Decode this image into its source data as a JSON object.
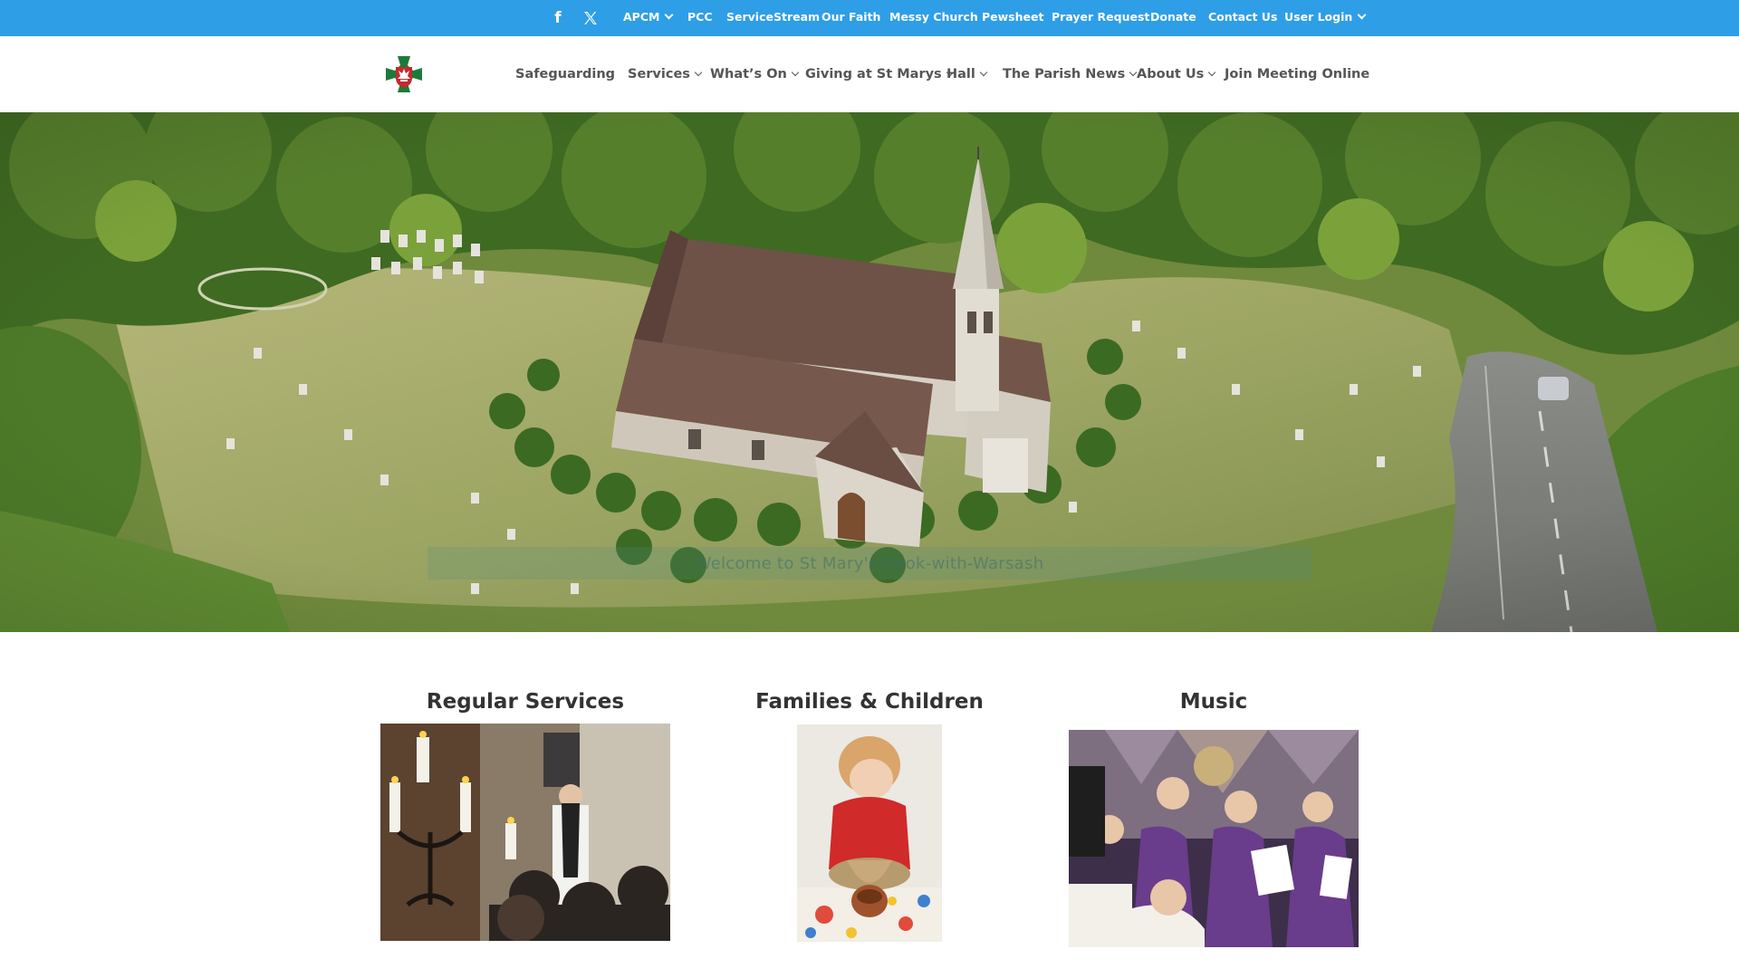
{
  "topbar": {
    "social": [
      "facebook-icon",
      "x-twitter-icon"
    ],
    "links": [
      {
        "label": "APCM",
        "dropdown": true
      },
      {
        "label": "PCC",
        "dropdown": false
      },
      {
        "label": "ServiceStream",
        "dropdown": false
      },
      {
        "label": "Our Faith",
        "dropdown": false
      },
      {
        "label": "Messy Church",
        "dropdown": false
      },
      {
        "label": "Pewsheet",
        "dropdown": false
      },
      {
        "label": "Prayer Request",
        "dropdown": false
      },
      {
        "label": "Donate",
        "dropdown": false
      },
      {
        "label": "Contact Us",
        "dropdown": false
      },
      {
        "label": "User Login",
        "dropdown": true
      }
    ]
  },
  "header": {
    "logo": "church-cross-logo",
    "nav": [
      {
        "label": "Safeguarding",
        "dropdown": false
      },
      {
        "label": "Services",
        "dropdown": true
      },
      {
        "label": "What’s On",
        "dropdown": true
      },
      {
        "label": "Giving at St Marys",
        "dropdown": true
      },
      {
        "label": "Hall",
        "dropdown": true
      },
      {
        "label": "The Parish News",
        "dropdown": true
      },
      {
        "label": "About Us",
        "dropdown": true
      },
      {
        "label": "Join Meeting Online",
        "dropdown": false
      }
    ]
  },
  "hero": {
    "banner_text": "Welcome to St Mary's Hook-with-Warsash"
  },
  "sections": [
    {
      "title": "Regular Services"
    },
    {
      "title": "Families & Children"
    },
    {
      "title": "Music"
    }
  ],
  "colors": {
    "topbar_bg": "#2e9ee6",
    "nav_text": "#555555",
    "heading_text": "#333333",
    "logo_green": "#1d7a3a",
    "logo_red": "#c9282d"
  }
}
